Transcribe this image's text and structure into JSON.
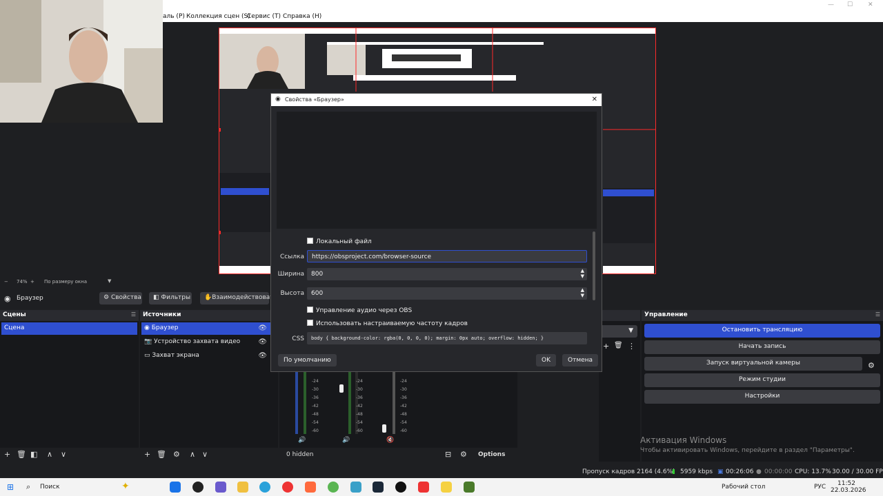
{
  "menu": {
    "items": [
      "аль (P)",
      "Коллекция сцен (S)",
      "Сервис (T)",
      "Справка (H)"
    ]
  },
  "zoom": {
    "percent": "74%",
    "mode": "По размеру окна"
  },
  "source_toolbar": {
    "current_source": "Браузер",
    "properties": "Свойства",
    "filters": "Фильтры",
    "interact": "Взаимодействовать"
  },
  "scenes": {
    "title": "Сцены",
    "items": [
      "Сцена"
    ]
  },
  "sources": {
    "title": "Источники",
    "items": [
      "Браузер",
      "Устройство захвата видео",
      "Захват экрана"
    ]
  },
  "mixer": {
    "hidden_label": "0 hidden",
    "options_label": "Options",
    "ticks": [
      "-24",
      "-30",
      "-36",
      "-42",
      "-48",
      "-54",
      "-60"
    ]
  },
  "controls": {
    "title": "Управление",
    "buttons": [
      "Остановить трансляцию",
      "Начать запись",
      "Запуск виртуальной камеры",
      "Режим студии",
      "Настройки"
    ]
  },
  "dialog": {
    "title": "Свойства «Браузер»",
    "local_file": "Локальный файл",
    "url_label": "Ссылка",
    "url_value": "https://obsproject.com/browser-source",
    "width_label": "Ширина",
    "width_value": "800",
    "height_label": "Высота",
    "height_value": "600",
    "audio_obs": "Управление аудио через OBS",
    "custom_fps": "Использовать настраиваемую частоту кадров",
    "css_label": "CSS",
    "css_value": "body { background-color: rgba(0, 0, 0, 0); margin: 0px auto; overflow: hidden; }",
    "defaults_button": "По умолчанию",
    "ok_button": "OK",
    "cancel_button": "Отмена"
  },
  "status": {
    "dropped": "Пропуск кадров 2164 (4.6%)",
    "bitrate": "5959 kbps",
    "stream_time": "00:26:06",
    "rec_time": "00:00:00",
    "cpu": "CPU: 13.7%",
    "fps": "30.00 / 30.00 FPS"
  },
  "watermark": {
    "line1": "Активация Windows",
    "line2": "Чтобы активировать Windows, перейдите в раздел \"Параметры\"."
  },
  "taskbar": {
    "search": "Поиск",
    "desktop": "Рабочий стол",
    "lang": "РУС",
    "time": "11:52",
    "date": "22.03.2026"
  },
  "colors": {
    "accent": "#2f4fd0",
    "selection_border": "#ff2a2a",
    "panel": "#17181b"
  }
}
